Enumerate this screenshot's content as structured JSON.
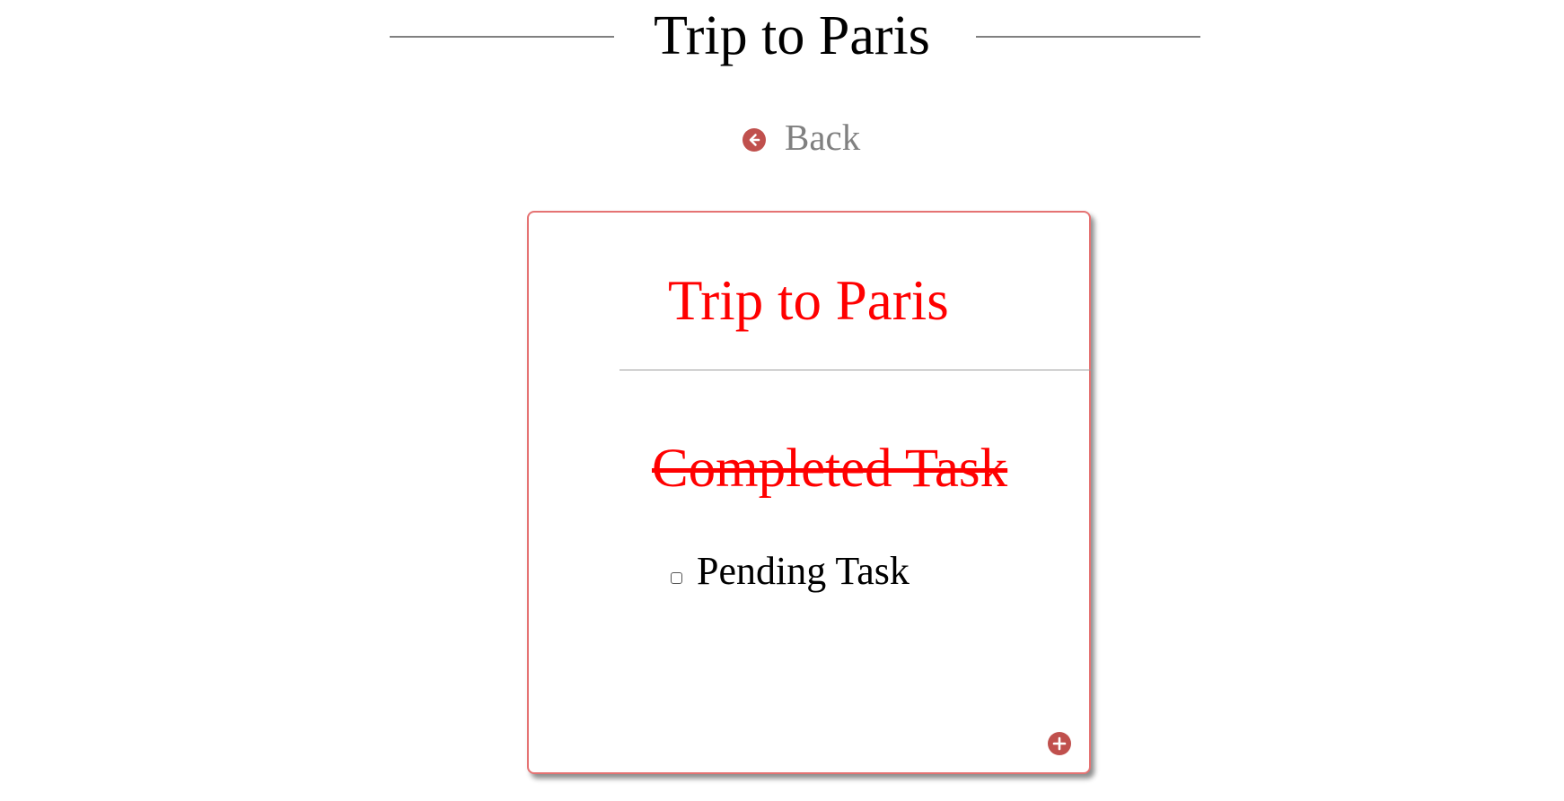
{
  "header": {
    "title": "Trip to Paris"
  },
  "navigation": {
    "back_label": "Back",
    "back_icon": "arrow-left-circle-icon"
  },
  "card": {
    "title": "Trip to Paris",
    "tasks": [
      {
        "label": "Completed Task",
        "completed": true
      },
      {
        "label": "Pending Task",
        "completed": false
      }
    ],
    "add_icon": "plus-circle-icon"
  },
  "colors": {
    "accent": "#c0504d",
    "title_red": "#ff0000",
    "card_border": "#e57373",
    "muted_text": "#808080"
  }
}
